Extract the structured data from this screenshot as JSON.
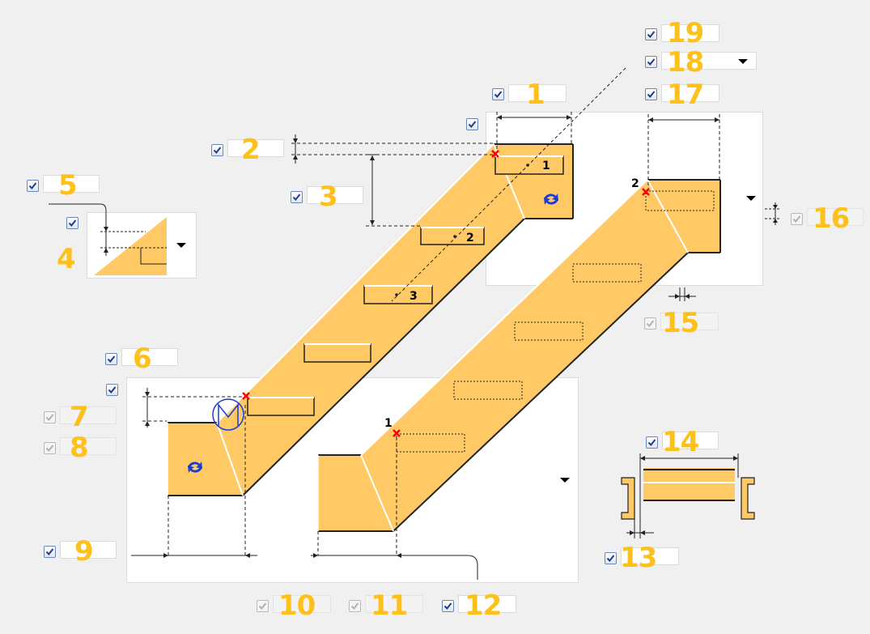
{
  "labels": {
    "p1": "1",
    "p2": "2",
    "p3": "3",
    "p4": "4",
    "p5": "5",
    "p6": "6",
    "p7": "7",
    "p8": "8",
    "p9": "9",
    "p10": "10",
    "p11": "11",
    "p12": "12",
    "p13": "13",
    "p14": "14",
    "p15": "15",
    "p16": "16",
    "p17": "17",
    "p18": "18",
    "p19": "19"
  },
  "diagram_markers": {
    "axis_1": "1",
    "axis_2": "2",
    "axis_3": "3",
    "point_1": "1",
    "point_2": "2"
  },
  "icons": {
    "checkbox": "checkmark-icon",
    "dropdown": "triangle-down-icon",
    "rotate": "rotate-arrows-icon",
    "motor": "motor-symbol-icon",
    "reference_point": "red-x-marker-icon"
  },
  "colors": {
    "accent_number": "#fec01b",
    "belt_fill": "#ffc966",
    "reference_marker": "#ff0000",
    "checkbox_border": "#6a87b6",
    "rotation_icon": "#1a3dd6"
  },
  "states": {
    "p1": true,
    "p2": true,
    "p3": true,
    "p4": true,
    "p5": true,
    "p6": true,
    "p7": false,
    "p8": false,
    "p9": true,
    "p10": false,
    "p11": false,
    "p12": true,
    "p13": true,
    "p14": true,
    "p15": false,
    "p16": false,
    "p17": true,
    "p18": true,
    "p19": true
  }
}
